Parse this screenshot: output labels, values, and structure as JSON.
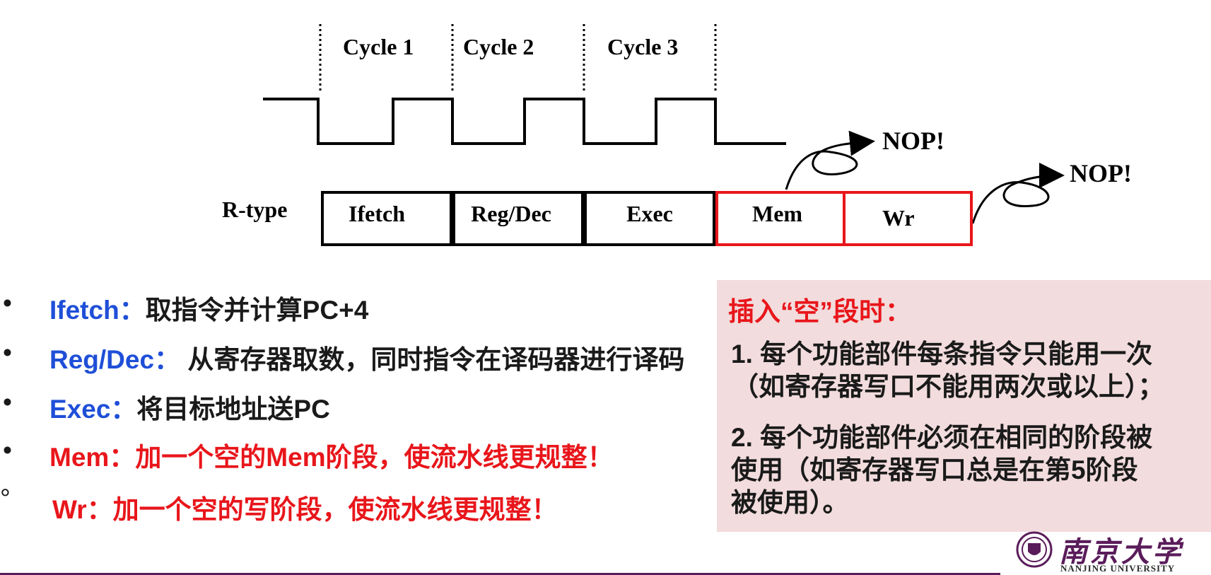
{
  "timing": {
    "cycles": [
      "Cycle 1",
      "Cycle 2",
      "Cycle 3"
    ],
    "row_label": "R-type",
    "stages": [
      "Ifetch",
      "Reg/Dec",
      "Exec",
      "Mem",
      "Wr"
    ],
    "nop_labels": [
      "NOP!",
      "NOP!"
    ]
  },
  "bullets": [
    {
      "marker": "•",
      "key": "Ifetch：",
      "desc": "取指令并计算PC+4",
      "style": "normal"
    },
    {
      "marker": "•",
      "key": "Reg/Dec：",
      "desc": " 从寄存器取数，同时指令在译码器进行译码",
      "style": "normal"
    },
    {
      "marker": "•",
      "key": "Exec：",
      "desc": "将目标地址送PC",
      "style": "normal"
    },
    {
      "marker": "•",
      "key": "Mem：",
      "desc": "加一个空的Mem阶段，使流水线更规整！",
      "style": "red"
    },
    {
      "marker": "°",
      "key": "Wr：",
      "desc": "加一个空的写阶段，使流水线更规整！",
      "style": "red"
    }
  ],
  "note": {
    "title": "插入“空”段时：",
    "item1_lines": [
      "1. 每个功能部件每条指令只能用一次",
      "（如寄存器写口不能用两次或以上）；"
    ],
    "item2_lines": [
      "2. 每个功能部件必须在相同的阶段被",
      "使用（如寄存器写口总是在第5阶段",
      "被使用）。"
    ]
  },
  "logo": {
    "name_cn": "南京大学",
    "name_en": "NANJING UNIVERSITY"
  },
  "colors": {
    "red": "#e8161b",
    "blue": "#1f4fd8",
    "panel": "#f2dcdd",
    "brand": "#5a1c5a"
  }
}
